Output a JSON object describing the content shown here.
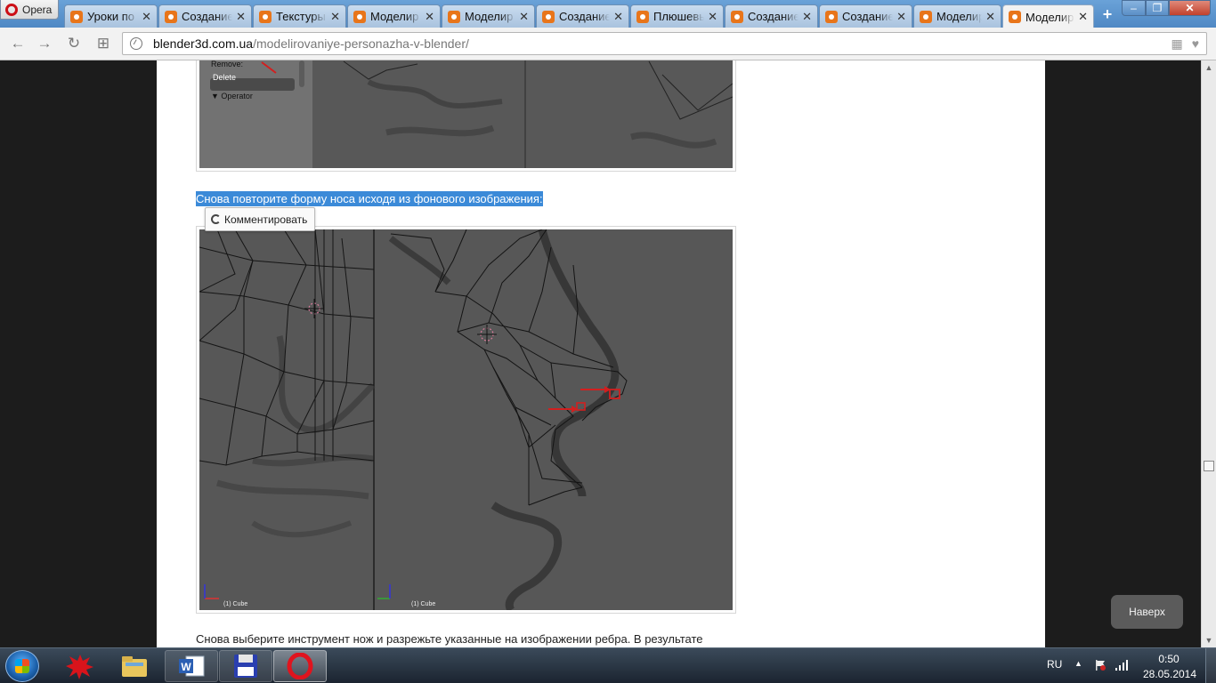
{
  "browser": {
    "menu_label": "Opera",
    "tabs": [
      {
        "title": "Уроки по",
        "active": false
      },
      {
        "title": "Создание",
        "active": false
      },
      {
        "title": "Текстуры",
        "active": false
      },
      {
        "title": "Моделир",
        "active": false
      },
      {
        "title": "Моделир",
        "active": false
      },
      {
        "title": "Создание",
        "active": false
      },
      {
        "title": "Плюшевы",
        "active": false
      },
      {
        "title": "Создание",
        "active": false
      },
      {
        "title": "Создание",
        "active": false
      },
      {
        "title": "Моделир",
        "active": false
      },
      {
        "title": "Моделир",
        "active": true
      }
    ],
    "tab_close_glyph": "✕",
    "new_tab_glyph": "+",
    "window_buttons": {
      "minimize": "–",
      "maximize": "❐",
      "close": "✕"
    },
    "nav": {
      "back": "←",
      "forward": "→",
      "reload": "↻",
      "speed_dial": "⊞"
    },
    "url": {
      "domain": "blender3d.com.ua",
      "path": "/modelirovaniye-personazha-v-blender/"
    }
  },
  "page": {
    "top_screenshot": {
      "remove_label": "Remove:",
      "remove_value": "Delete",
      "operator_label": "▼ Operator"
    },
    "highlighted_text": "Снова повторите форму носа исходя из фонового изображения:",
    "comment_button": "Комментировать",
    "main_screenshot": {
      "left_view_label": "(1) Cube",
      "right_view_label": "(1) Cube"
    },
    "body_text": "Снова выберите инструмент нож и разрежьте указанные на изображении ребра. В результате",
    "back_to_top": "Наверх"
  },
  "taskbar": {
    "apps": [
      "paint-splat",
      "file-explorer",
      "word",
      "save-disk",
      "opera"
    ],
    "language": "RU",
    "time": "0:50",
    "date": "28.05.2014"
  },
  "colors": {
    "selection": "#3b8ad8",
    "blender_viewport": "#575757",
    "blender_panel": "#727272",
    "marker_red": "#d21f1f"
  }
}
